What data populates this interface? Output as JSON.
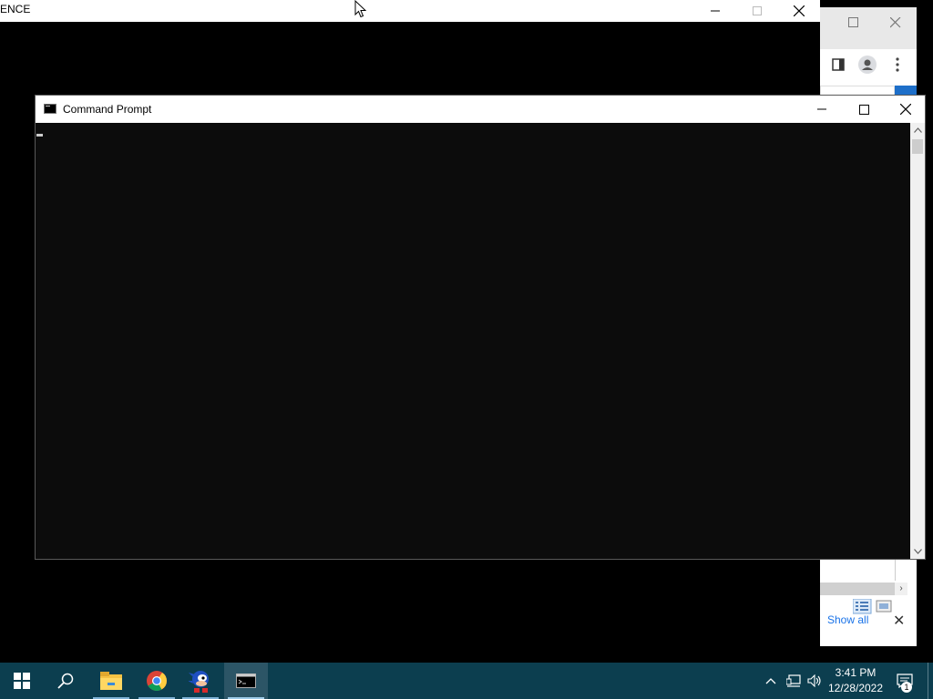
{
  "background_window": {
    "title_fragment": "ENCE"
  },
  "cmd_window": {
    "title": "Command Prompt",
    "controls": {
      "minimize": "minimize-icon",
      "maximize": "maximize-icon",
      "close": "close-icon"
    }
  },
  "browser_fragment": {
    "show_all_label": "Show all"
  },
  "taskbar": {
    "items": [
      {
        "name": "start-button",
        "icon": "windows-logo-icon"
      },
      {
        "name": "search-button",
        "icon": "search-icon"
      },
      {
        "name": "file-explorer",
        "icon": "folder-icon"
      },
      {
        "name": "chrome",
        "icon": "chrome-icon"
      },
      {
        "name": "game-app",
        "icon": "game-character-icon"
      },
      {
        "name": "command-prompt",
        "icon": "cmd-icon",
        "active": true
      }
    ],
    "clock_time": "3:41 PM",
    "clock_date": "12/28/2022",
    "notification_count": "1"
  },
  "colors": {
    "taskbar": "#0c3e4f",
    "console_bg": "#0c0c0c",
    "desktop_accent": "#1e6fc9"
  }
}
